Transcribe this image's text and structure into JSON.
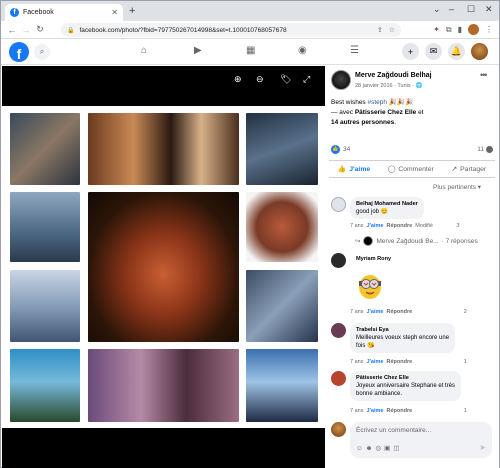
{
  "browser": {
    "tab_title": "Facebook",
    "url": "facebook.com/photo/?fbid=797750267014998&set=t.100010768057678"
  },
  "post": {
    "author": "Merve Zağdoudi Belhaj",
    "date": "28 janvier 2016 · Tunis · ",
    "text_line1": "Best wishes ",
    "hashtag": "#steph",
    "emoji_line1": " 🎉🎉🎉",
    "text_line2_prefix": "— avec ",
    "with_name": "Pâtisserie Chez Elle",
    "text_line2_suffix": " et",
    "others": "14 autres personnes",
    "reactions_count": "34",
    "comments_count": "11",
    "like_label": "J'aime",
    "comment_label": "Commenter",
    "share_label": "Partager",
    "sort_label": "Plus pertinents"
  },
  "comments": [
    {
      "name": "Belhaj Mohamed Nader",
      "text": "good job 😊",
      "meta_time": "7 ans",
      "like": "J'aime",
      "reply": "Répondre",
      "edited": "Modifié",
      "reactions": "3"
    },
    {
      "name": "Myriam Rony",
      "text": "",
      "meta_time": "7 ans",
      "like": "J'aime",
      "reply": "Répondre",
      "reactions": "2"
    },
    {
      "name": "Trabelsi Eya",
      "text_line1": "Meilleures voeux steph encore une",
      "text_line2": "fois 😘",
      "meta_time": "7 ans",
      "like": "J'aime",
      "reply": "Répondre",
      "reactions": "1"
    },
    {
      "name": "Pâtisserie Chez Elle",
      "text_line1": "Joyeux anniversaire Stephane et très",
      "text_line2": "bonne ambiance.",
      "meta_time": "7 ans",
      "like": "J'aime",
      "reply": "Répondre",
      "reactions": "1"
    }
  ],
  "reply_thread": {
    "author": "Merve Zağdoudi Be...",
    "count": "· 7 réponses"
  },
  "composer": {
    "placeholder": "Écrivez un commentaire..."
  },
  "colors": {
    "fb_blue": "#1877f2",
    "link_blue": "#385898",
    "bubble_bg": "#f0f2f5"
  }
}
